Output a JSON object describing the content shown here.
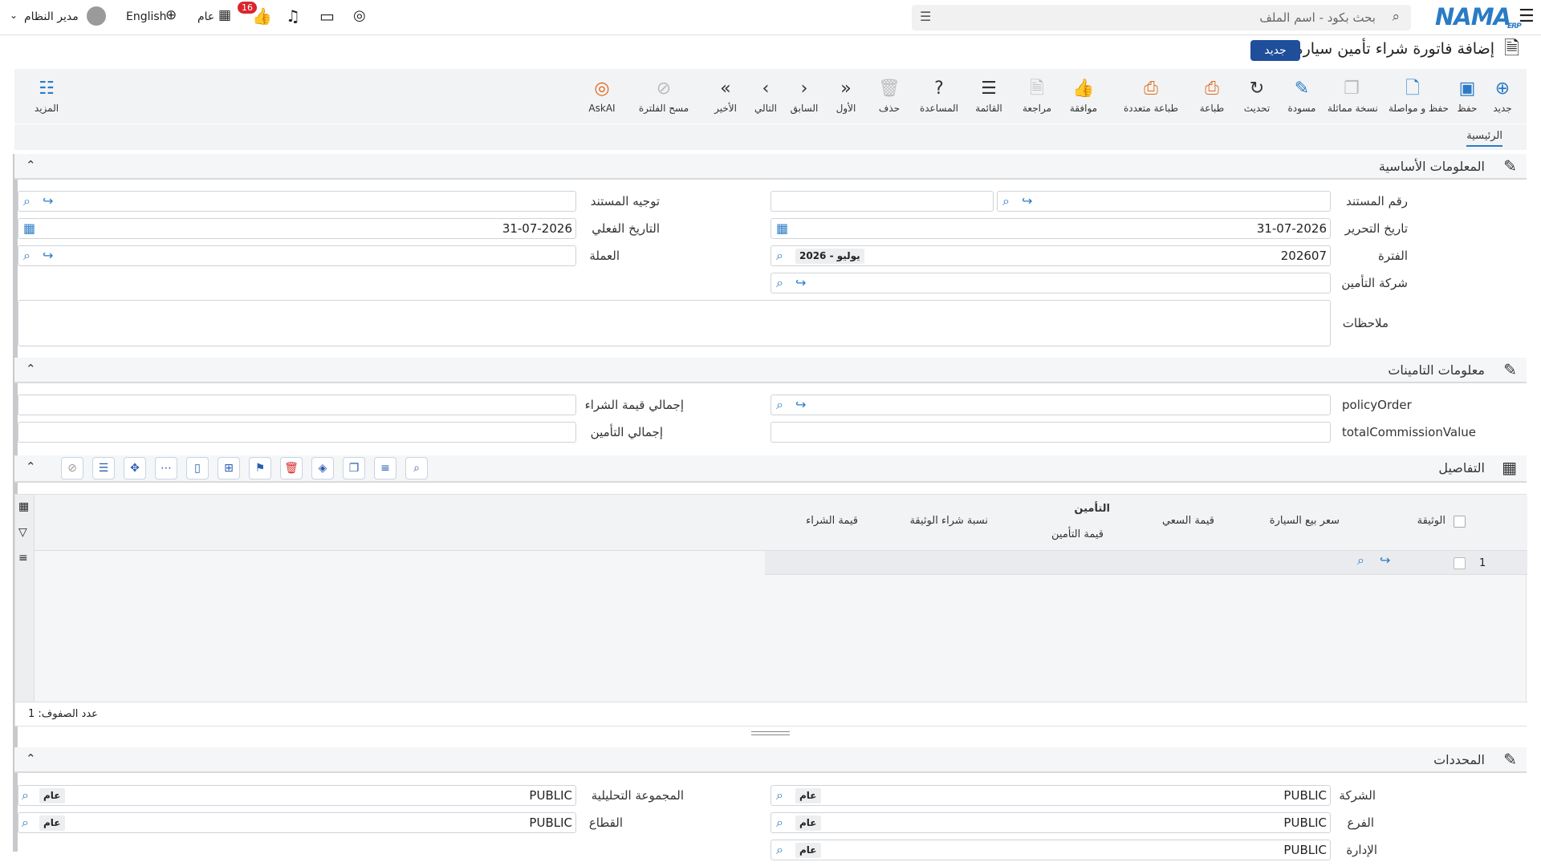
{
  "topbar": {
    "search_placeholder": "بحث بكود - اسم الملف",
    "logo": "NAMA",
    "logo_sub": "ERP",
    "user_name": "مدير النظام",
    "language": "English",
    "scope": "عام",
    "notif_count": "16"
  },
  "page": {
    "title": "إضافة فاتورة شراء تأمين سيارة",
    "new_badge": "جديد"
  },
  "toolbar": {
    "new": "جديد",
    "save": "حفظ",
    "save_continue": "حفظ و مواصلة",
    "duplicate": "نسخة مماثلة",
    "draft": "مسودة",
    "refresh": "تحديث",
    "print": "طباعة",
    "multi_print": "طباعة متعددة",
    "approve": "موافقة",
    "review": "مراجعة",
    "list": "القائمة",
    "help": "المساعدة",
    "delete": "حذف",
    "first": "الأول",
    "prev": "السابق",
    "next": "التالي",
    "last": "الأخير",
    "clear_filter": "مسح الفلترة",
    "askai": "AskAI",
    "more": "المزيد"
  },
  "tabs": {
    "main": "الرئيسية"
  },
  "basic": {
    "title": "المعلومات الأساسية",
    "doc_no": "رقم المستند",
    "doc_direction": "توجيه المستند",
    "edit_date": "تاريخ التحرير",
    "edit_date_val": "31-07-2026",
    "actual_date": "التاريخ الفعلي",
    "actual_date_val": "31-07-2026",
    "period": "الفترة",
    "period_val": "202607",
    "period_tag": "2026 - يوليو",
    "currency": "العملة",
    "insurance_co": "شركة التأمين",
    "notes": "ملاحظات"
  },
  "insurance": {
    "title": "معلومات التامينات",
    "policy_order": "policyOrder",
    "total_purchase": "إجمالي قيمة الشراء",
    "total_commission": "totalCommissionValue",
    "total_insurance": "إجمالي التأمين"
  },
  "details": {
    "title": "التفاصيل",
    "columns": [
      "الوثيقة",
      "سعر بيع السيارة",
      "قيمة السعي",
      "التأمين",
      "قيمة التأمين",
      "نسبة شراء الوثيقة",
      "قيمة الشراء"
    ],
    "row_no": "1",
    "row_count": "عدد الصفوف: 1"
  },
  "dims": {
    "title": "المحددات",
    "company": "الشركة",
    "branch": "الفرع",
    "dept": "الإدارة",
    "analytic": "المجموعة التحليلية",
    "sector": "القطاع",
    "public": "PUBLIC",
    "general": "عام"
  }
}
